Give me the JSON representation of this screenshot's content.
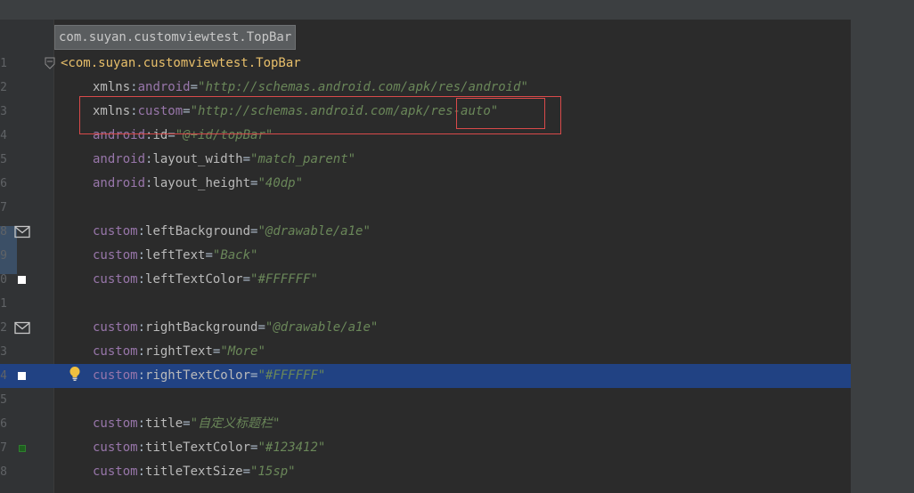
{
  "breadcrumb": "com.suyan.customviewtest.TopBar",
  "lines": [
    {
      "num": "1",
      "parts": [
        [
          "t-tag",
          "<com.suyan.customviewtest.TopBar"
        ]
      ],
      "top": true
    },
    {
      "num": "2",
      "parts": [
        [
          "t-attr",
          "xmlns"
        ],
        [
          "t-eq",
          ":"
        ],
        [
          "t-ns",
          "android"
        ],
        [
          "t-eq",
          "="
        ],
        [
          "t-str",
          "\"http://schemas.android.com/apk/res/android\""
        ]
      ]
    },
    {
      "num": "3",
      "parts": [
        [
          "t-attr",
          "xmlns"
        ],
        [
          "t-eq",
          ":"
        ],
        [
          "t-ns",
          "custom"
        ],
        [
          "t-eq",
          "="
        ],
        [
          "t-str",
          "\"http://schemas.android.com/apk/res-auto\""
        ]
      ]
    },
    {
      "num": "4",
      "parts": [
        [
          "t-ns",
          "android"
        ],
        [
          "t-eq",
          ":"
        ],
        [
          "t-attr",
          "id"
        ],
        [
          "t-eq",
          "="
        ],
        [
          "t-str",
          "\"@+id/topBar\""
        ]
      ]
    },
    {
      "num": "5",
      "parts": [
        [
          "t-ns",
          "android"
        ],
        [
          "t-eq",
          ":"
        ],
        [
          "t-attr",
          "layout_width"
        ],
        [
          "t-eq",
          "="
        ],
        [
          "t-str",
          "\"match_parent\""
        ]
      ]
    },
    {
      "num": "6",
      "parts": [
        [
          "t-ns",
          "android"
        ],
        [
          "t-eq",
          ":"
        ],
        [
          "t-attr",
          "layout_height"
        ],
        [
          "t-eq",
          "="
        ],
        [
          "t-str",
          "\"40dp\""
        ]
      ]
    },
    {
      "num": "7",
      "parts": []
    },
    {
      "num": "8",
      "parts": [
        [
          "t-ns",
          "custom"
        ],
        [
          "t-eq",
          ":"
        ],
        [
          "t-attr",
          "leftBackground"
        ],
        [
          "t-eq",
          "="
        ],
        [
          "t-str",
          "\"@drawable/a1e\""
        ]
      ],
      "icon": "envelope"
    },
    {
      "num": "9",
      "parts": [
        [
          "t-ns",
          "custom"
        ],
        [
          "t-eq",
          ":"
        ],
        [
          "t-attr",
          "leftText"
        ],
        [
          "t-eq",
          "="
        ],
        [
          "t-str",
          "\"Back\""
        ]
      ]
    },
    {
      "num": "0",
      "parts": [
        [
          "t-ns",
          "custom"
        ],
        [
          "t-eq",
          ":"
        ],
        [
          "t-attr",
          "leftTextColor"
        ],
        [
          "t-eq",
          "="
        ],
        [
          "t-str",
          "\"#FFFFFF\""
        ]
      ],
      "icon": "white-square"
    },
    {
      "num": "1",
      "parts": []
    },
    {
      "num": "2",
      "parts": [
        [
          "t-ns",
          "custom"
        ],
        [
          "t-eq",
          ":"
        ],
        [
          "t-attr",
          "rightBackground"
        ],
        [
          "t-eq",
          "="
        ],
        [
          "t-str",
          "\"@drawable/a1e\""
        ]
      ],
      "icon": "envelope"
    },
    {
      "num": "3",
      "parts": [
        [
          "t-ns",
          "custom"
        ],
        [
          "t-eq",
          ":"
        ],
        [
          "t-attr",
          "rightText"
        ],
        [
          "t-eq",
          "="
        ],
        [
          "t-str",
          "\"More\""
        ]
      ]
    },
    {
      "num": "4",
      "parts": [
        [
          "t-ns",
          "custom"
        ],
        [
          "t-eq",
          ":"
        ],
        [
          "t-attr",
          "rightTextColor"
        ],
        [
          "t-eq",
          "="
        ],
        [
          "t-str",
          "\"#FFFFFF\""
        ]
      ],
      "icon": "white-square",
      "highlight": true,
      "bulb": true
    },
    {
      "num": "5",
      "parts": []
    },
    {
      "num": "6",
      "parts": [
        [
          "t-ns",
          "custom"
        ],
        [
          "t-eq",
          ":"
        ],
        [
          "t-attr",
          "title"
        ],
        [
          "t-eq",
          "="
        ],
        [
          "t-str",
          "\"自定义标题栏\""
        ]
      ]
    },
    {
      "num": "7",
      "parts": [
        [
          "t-ns",
          "custom"
        ],
        [
          "t-eq",
          ":"
        ],
        [
          "t-attr",
          "titleTextColor"
        ],
        [
          "t-eq",
          "="
        ],
        [
          "t-str",
          "\"#123412\""
        ]
      ],
      "icon": "green-square"
    },
    {
      "num": "8",
      "parts": [
        [
          "t-ns",
          "custom"
        ],
        [
          "t-eq",
          ":"
        ],
        [
          "t-attr",
          "titleTextSize"
        ],
        [
          "t-eq",
          "="
        ],
        [
          "t-str",
          "\"15sp\""
        ]
      ]
    }
  ],
  "colors": {
    "highlight": "#214283",
    "annotation": "#d94a4a",
    "string": "#6a8759",
    "namespace": "#9876aa",
    "tag": "#e8bf6a"
  }
}
